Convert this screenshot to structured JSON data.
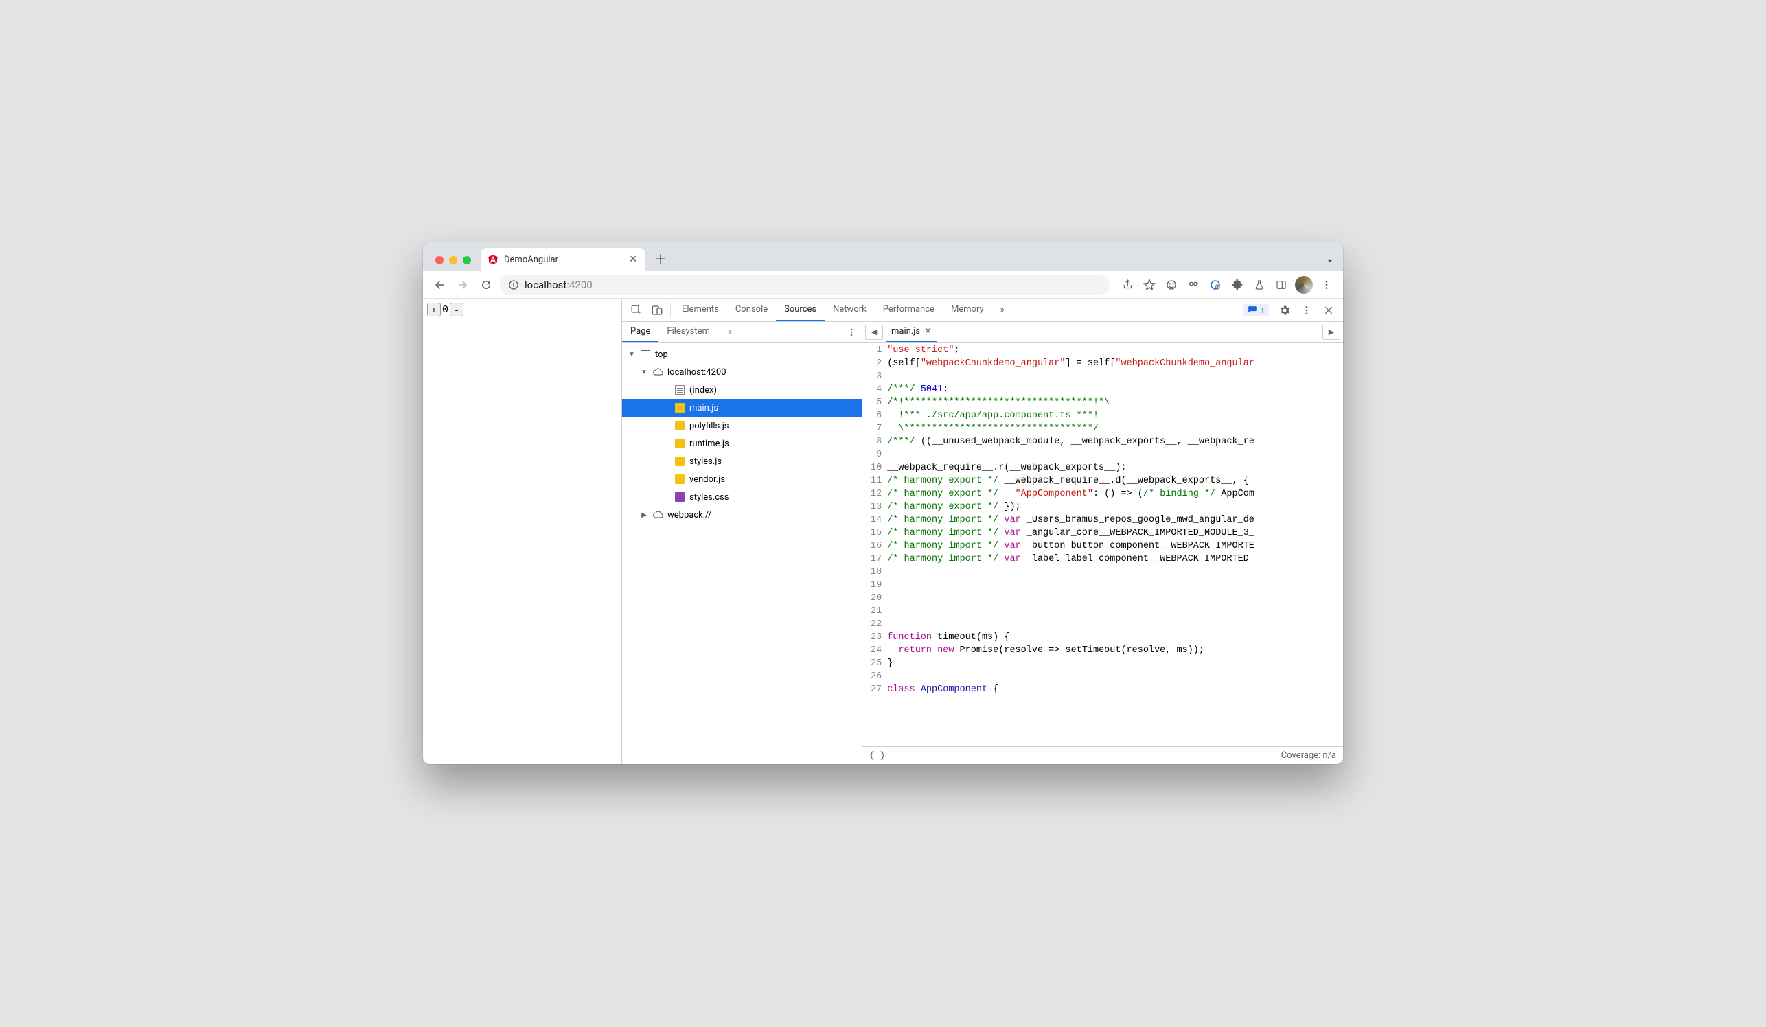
{
  "browser": {
    "tab_title": "DemoAngular",
    "url_host": "localhost",
    "url_port": ":4200"
  },
  "page": {
    "counter_value": "0"
  },
  "devtools": {
    "tabs": [
      "Elements",
      "Console",
      "Sources",
      "Network",
      "Performance",
      "Memory"
    ],
    "active_tab": "Sources",
    "issues_count": "1",
    "sources": {
      "side_tabs": [
        "Page",
        "Filesystem"
      ],
      "active_side_tab": "Page",
      "tree": {
        "top": "top",
        "origin": "localhost:4200",
        "files": [
          {
            "name": "(index)",
            "type": "doc"
          },
          {
            "name": "main.js",
            "type": "js",
            "selected": true
          },
          {
            "name": "polyfills.js",
            "type": "js"
          },
          {
            "name": "runtime.js",
            "type": "js"
          },
          {
            "name": "styles.js",
            "type": "js"
          },
          {
            "name": "vendor.js",
            "type": "js"
          },
          {
            "name": "styles.css",
            "type": "css"
          }
        ],
        "webpack": "webpack://"
      }
    },
    "editor": {
      "open_file": "main.js",
      "coverage": "Coverage: n/a",
      "lines": [
        [
          {
            "t": "str",
            "s": "\"use strict\""
          },
          {
            "t": "id",
            "s": ";"
          }
        ],
        [
          {
            "t": "id",
            "s": "(self["
          },
          {
            "t": "str",
            "s": "\"webpackChunkdemo_angular\""
          },
          {
            "t": "id",
            "s": "] = self["
          },
          {
            "t": "str",
            "s": "\"webpackChunkdemo_angular"
          }
        ],
        [],
        [
          {
            "t": "com",
            "s": "/***/ "
          },
          {
            "t": "num",
            "s": "5041"
          },
          {
            "t": "id",
            "s": ":"
          }
        ],
        [
          {
            "t": "com",
            "s": "/*!**********************************!*\\"
          }
        ],
        [
          {
            "t": "com",
            "s": "  !*** ./src/app/app.component.ts ***!"
          }
        ],
        [
          {
            "t": "com",
            "s": "  \\**********************************/"
          }
        ],
        [
          {
            "t": "com",
            "s": "/***/ "
          },
          {
            "t": "id",
            "s": "((__unused_webpack_module, __webpack_exports__, __webpack_re"
          }
        ],
        [],
        [
          {
            "t": "id",
            "s": "__webpack_require__.r(__webpack_exports__);"
          }
        ],
        [
          {
            "t": "com",
            "s": "/* harmony export */ "
          },
          {
            "t": "id",
            "s": "__webpack_require__.d(__webpack_exports__, {"
          }
        ],
        [
          {
            "t": "com",
            "s": "/* harmony export */   "
          },
          {
            "t": "str",
            "s": "\"AppComponent\""
          },
          {
            "t": "id",
            "s": ": () => ("
          },
          {
            "t": "com",
            "s": "/* binding */"
          },
          {
            "t": "id",
            "s": " AppCom"
          }
        ],
        [
          {
            "t": "com",
            "s": "/* harmony export */ "
          },
          {
            "t": "id",
            "s": "});"
          }
        ],
        [
          {
            "t": "com",
            "s": "/* harmony import */ "
          },
          {
            "t": "key",
            "s": "var"
          },
          {
            "t": "id",
            "s": " _Users_bramus_repos_google_mwd_angular_de"
          }
        ],
        [
          {
            "t": "com",
            "s": "/* harmony import */ "
          },
          {
            "t": "key",
            "s": "var"
          },
          {
            "t": "id",
            "s": " _angular_core__WEBPACK_IMPORTED_MODULE_3_"
          }
        ],
        [
          {
            "t": "com",
            "s": "/* harmony import */ "
          },
          {
            "t": "key",
            "s": "var"
          },
          {
            "t": "id",
            "s": " _button_button_component__WEBPACK_IMPORTE"
          }
        ],
        [
          {
            "t": "com",
            "s": "/* harmony import */ "
          },
          {
            "t": "key",
            "s": "var"
          },
          {
            "t": "id",
            "s": " _label_label_component__WEBPACK_IMPORTED_"
          }
        ],
        [],
        [],
        [],
        [],
        [],
        [
          {
            "t": "key",
            "s": "function"
          },
          {
            "t": "id",
            "s": " timeout(ms) {"
          }
        ],
        [
          {
            "t": "id",
            "s": "  "
          },
          {
            "t": "key",
            "s": "return"
          },
          {
            "t": "id",
            "s": " "
          },
          {
            "t": "key",
            "s": "new"
          },
          {
            "t": "id",
            "s": " Promise(resolve => setTimeout(resolve, ms));"
          }
        ],
        [
          {
            "t": "id",
            "s": "}"
          }
        ],
        [],
        [
          {
            "t": "key",
            "s": "class"
          },
          {
            "t": "id",
            "s": " "
          },
          {
            "t": "def",
            "s": "AppComponent"
          },
          {
            "t": "id",
            "s": " {"
          }
        ]
      ]
    }
  }
}
